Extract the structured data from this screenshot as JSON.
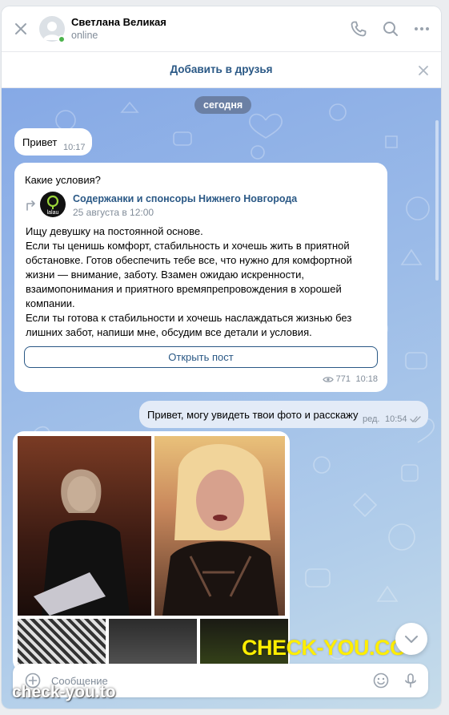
{
  "header": {
    "contact_name": "Светлана Великая",
    "status": "online",
    "icons": [
      "close-icon",
      "phone-icon",
      "search-icon",
      "more-icon"
    ]
  },
  "friend_bar": {
    "label": "Добавить в друзья"
  },
  "chat": {
    "date_divider": "сегодня",
    "msg1": {
      "text": "Привет",
      "time": "10:17"
    },
    "msg2": {
      "text": "Какие условия?",
      "post": {
        "group_name": "Содержанки и спонсоры Нижнего Новгорода",
        "group_avatar_text": "lalau",
        "date": "25 августа в 12:00",
        "body": "Ищу девушку на постоянной основе.\nЕсли ты ценишь комфорт, стабильность и хочешь жить в приятной обстановке. Готов обеспечить тебе все, что нужно для комфортной жизни — внимание, заботу. Взамен ожидаю искренности, взаимопонимания и приятного времяпрепровождения в хорошей компании.\nЕсли ты готова к стабильности и хочешь наслаждаться жизнью без лишних забот, напиши мне, обсудим все детали и условия.",
        "open_button": "Открыть пост",
        "views": "771"
      },
      "time": "10:18"
    },
    "msg3": {
      "text": "Привет, могу увидеть твои фото и расскажу",
      "edited": "ред.",
      "time": "10:54"
    }
  },
  "watermark": "CHECK-YOU.CO",
  "site_mark": "check-you.to",
  "composer": {
    "placeholder": "Сообщение"
  },
  "colors": {
    "link": "#2a5885",
    "online": "#4bb34b",
    "watermark": "#ffee00"
  }
}
